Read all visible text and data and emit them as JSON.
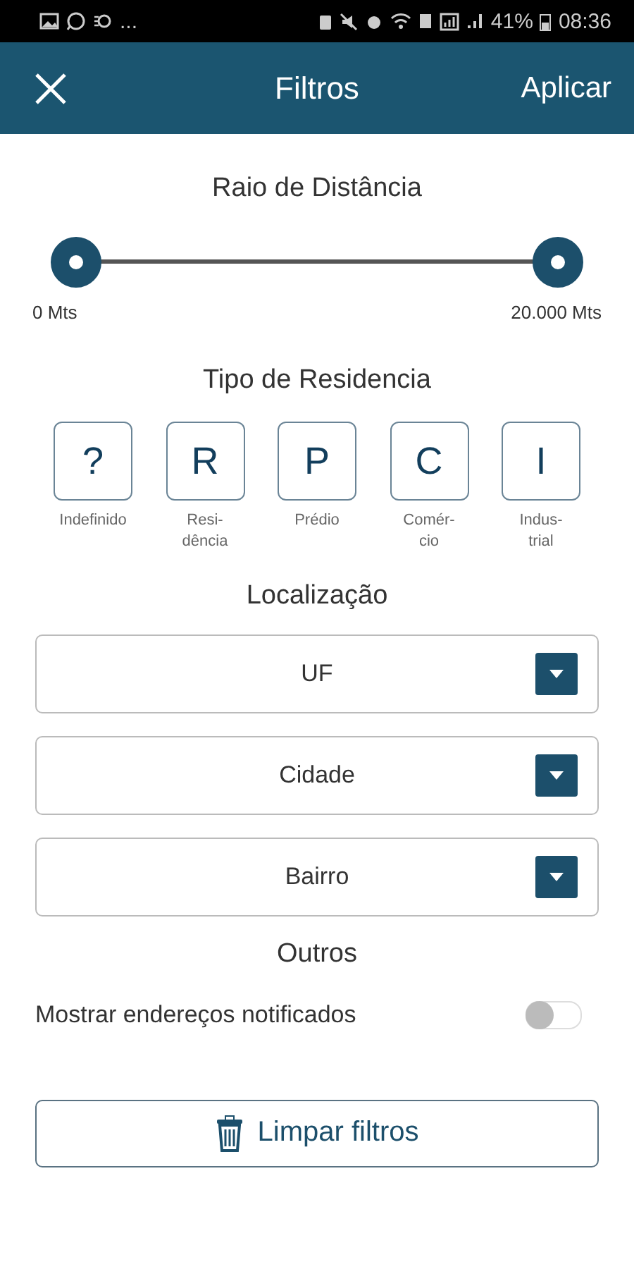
{
  "status_bar": {
    "overflow": "...",
    "battery": "41%",
    "time": "08:36"
  },
  "header": {
    "title": "Filtros",
    "action": "Aplicar"
  },
  "distance": {
    "title": "Raio de Distância",
    "handles": [
      {
        "level": 0
      },
      {
        "level": 1
      }
    ],
    "min_label": "0 Mts",
    "max_label": "20.000 Mts"
  },
  "residence": {
    "title": "Tipo de Residencia",
    "types": [
      {
        "letter": "?",
        "label": "Indefinido",
        "selected": false
      },
      {
        "letter": "R",
        "label": "Resi-\ndência",
        "selected": false
      },
      {
        "letter": "P",
        "label": "Prédio",
        "selected": false
      },
      {
        "letter": "C",
        "label": "Comér-\ncio",
        "selected": false
      },
      {
        "letter": "I",
        "label": "Indus-\ntrial",
        "selected": false
      }
    ]
  },
  "location": {
    "title": "Localização",
    "selects": [
      {
        "placeholder": "UF"
      },
      {
        "placeholder": "Cidade"
      },
      {
        "placeholder": "Bairro"
      }
    ]
  },
  "others": {
    "title": "Outros",
    "toggle_label": "Mostrar endereços notificados",
    "on": false
  },
  "clear_button": "Limpar filtros"
}
